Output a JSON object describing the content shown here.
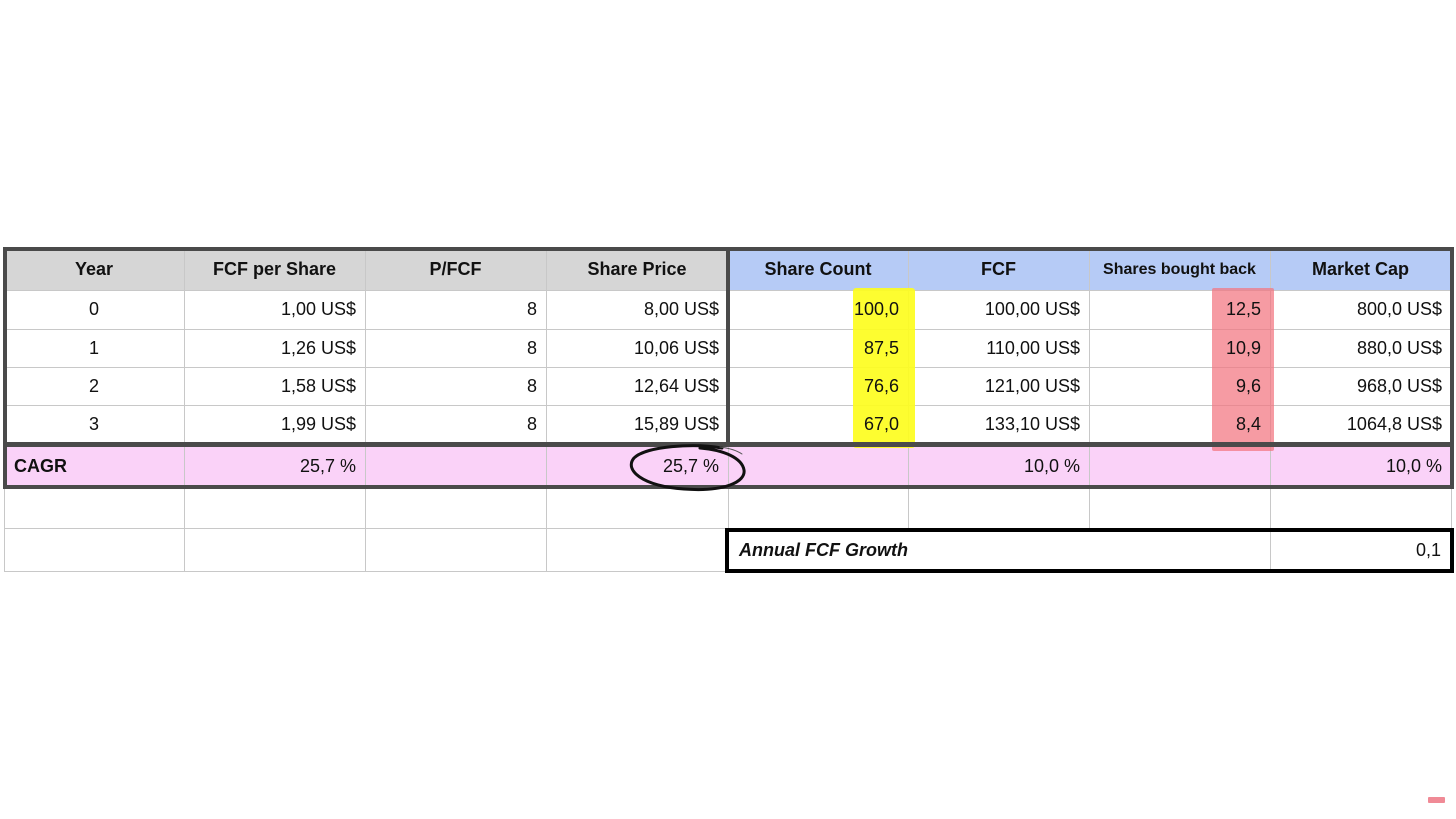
{
  "table": {
    "headers": [
      "Year",
      "FCF per Share",
      "P/FCF",
      "Share Price",
      "Share Count",
      "FCF",
      "Shares bought back",
      "Market Cap"
    ],
    "rows": [
      [
        "0",
        "1,00 US$",
        "8",
        "8,00 US$",
        "100,0",
        "100,00 US$",
        "12,5",
        "800,0 US$"
      ],
      [
        "1",
        "1,26 US$",
        "8",
        "10,06 US$",
        "87,5",
        "110,00 US$",
        "10,9",
        "880,0 US$"
      ],
      [
        "2",
        "1,58 US$",
        "8",
        "12,64 US$",
        "76,6",
        "121,00 US$",
        "9,6",
        "968,0 US$"
      ],
      [
        "3",
        "1,99 US$",
        "8",
        "15,89 US$",
        "67,0",
        "133,10 US$",
        "8,4",
        "1064,8 US$"
      ]
    ],
    "cagr": {
      "label": "CAGR",
      "fcf_per_share": "25,7 %",
      "share_price": "25,7 %",
      "fcf": "10,0 %",
      "market_cap": "10,0 %"
    }
  },
  "growth_input": {
    "label": "Annual FCF Growth",
    "value": "0,1"
  },
  "colors": {
    "header_gray": "#d6d6d6",
    "header_blue": "#b6cbf6",
    "cagr_pink": "#fad2f8",
    "highlight_yellow": "#fdfd1e",
    "highlight_red": "#f2747f"
  }
}
